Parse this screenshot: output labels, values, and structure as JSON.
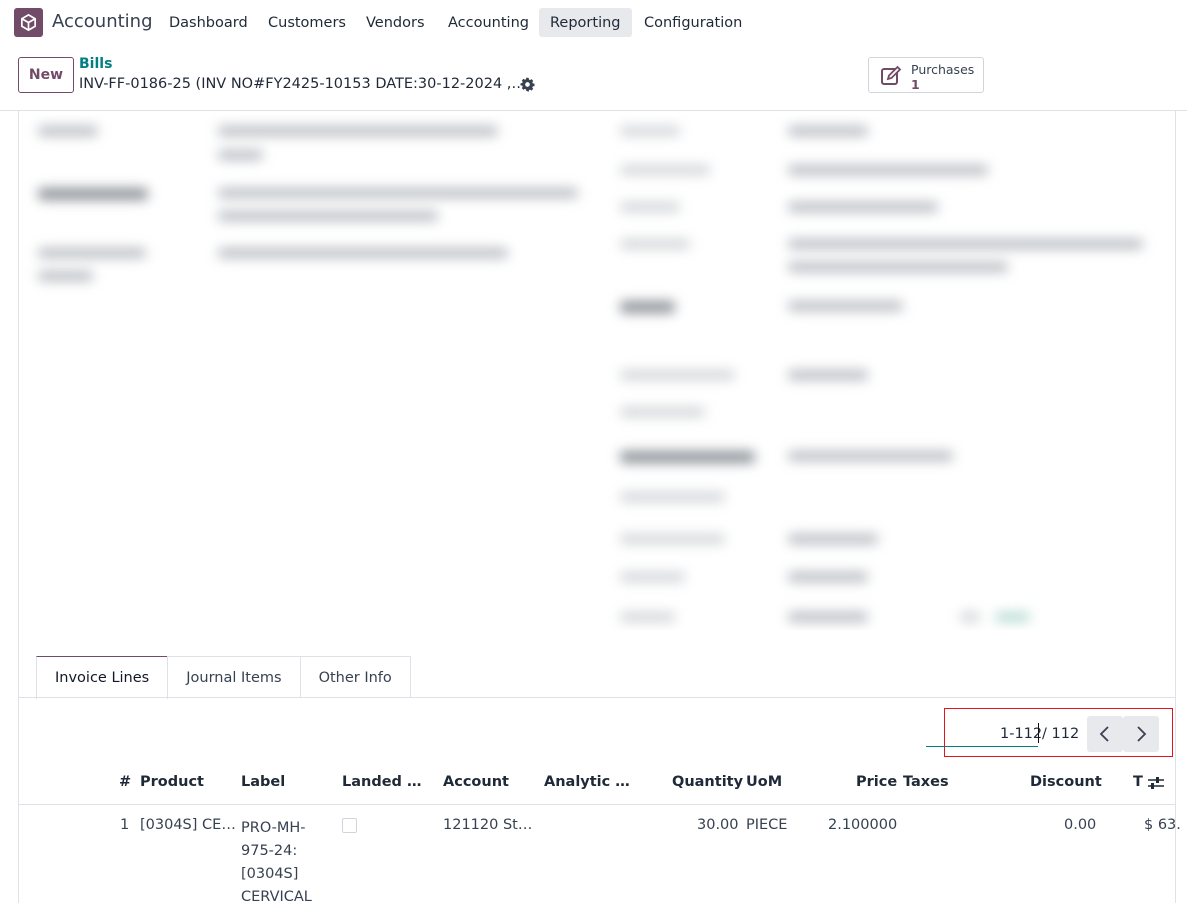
{
  "navbar": {
    "app_name": "Accounting",
    "menu": [
      "Dashboard",
      "Customers",
      "Vendors",
      "Accounting",
      "Reporting",
      "Configuration"
    ],
    "active_menu": "Reporting"
  },
  "control_panel": {
    "new_label": "New",
    "breadcrumb_parent": "Bills",
    "record_title": "INV-FF-0186-25 (INV NO#FY2425-10153 DATE:30-12-2024 ,…",
    "smart_button": {
      "label": "Purchases",
      "value": "1",
      "icon": "edit-icon"
    }
  },
  "tabs": [
    "Invoice Lines",
    "Journal Items",
    "Other Info"
  ],
  "active_tab": "Invoice Lines",
  "pager": {
    "value": "1-112",
    "total": "/ 112",
    "prev_icon": "chevron-left-icon",
    "next_icon": "chevron-right-icon"
  },
  "table": {
    "headers": [
      "#",
      "Product",
      "Label",
      "Landed …",
      "Account",
      "Analytic …",
      "Quantity",
      "UoM",
      "Price",
      "Taxes",
      "Discount",
      "T"
    ],
    "rows": [
      {
        "num": "1",
        "product": "[0304S] CE…",
        "label_lines": [
          "PRO-MH-",
          "975-24:",
          "[0304S]",
          "CERVICAL"
        ],
        "landed": false,
        "account": "121120 St…",
        "analytic": "",
        "quantity": "30.00",
        "uom": "PIECE",
        "price": "2.100000",
        "taxes": "",
        "discount": "0.00",
        "total": "$ 63."
      }
    ]
  },
  "colors": {
    "brand": "#714b67",
    "link": "#017e84",
    "highlight": "#e0161b"
  }
}
